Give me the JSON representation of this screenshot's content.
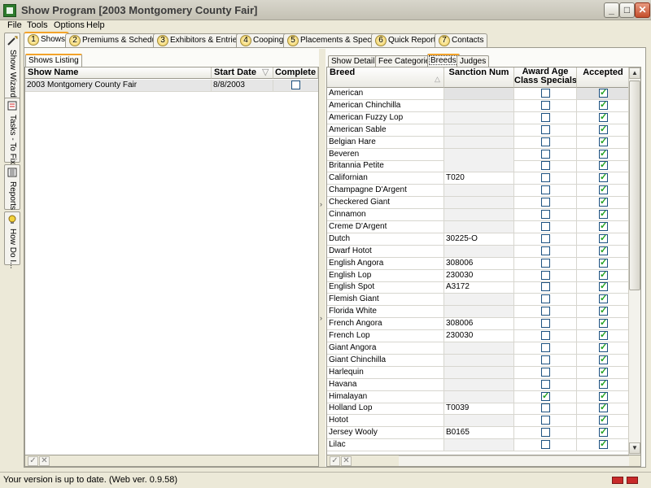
{
  "window": {
    "title": "Show Program [2003 Montgomery County Fair]"
  },
  "menu": [
    "File",
    "Tools",
    "Options",
    "Help"
  ],
  "sidebar": [
    {
      "label": "Show Wizard",
      "icon": "wizard-icon"
    },
    {
      "label": "Tasks - To Fix",
      "icon": "tasks-icon"
    },
    {
      "label": "Reports",
      "icon": "reports-icon"
    },
    {
      "label": "How Do I...",
      "icon": "help-bulb-icon"
    }
  ],
  "main_tabs": [
    {
      "num": "1",
      "label": "Shows"
    },
    {
      "num": "2",
      "label": "Premiums & Schedules"
    },
    {
      "num": "3",
      "label": "Exhibitors & Entries"
    },
    {
      "num": "4",
      "label": "Cooping"
    },
    {
      "num": "5",
      "label": "Placements & Specials"
    },
    {
      "num": "6",
      "label": "Quick Reports"
    },
    {
      "num": "7",
      "label": "Contacts"
    }
  ],
  "left_panel": {
    "tab": "Shows Listing",
    "headers": {
      "name": "Show Name",
      "date": "Start Date",
      "complete": "Complete"
    },
    "rows": [
      {
        "name": "2003 Montgomery County Fair",
        "date": "8/8/2003",
        "complete": false
      }
    ]
  },
  "right_panel": {
    "tabs": [
      "Show Details",
      "Fee Categories",
      "Breeds",
      "Judges"
    ],
    "headers": {
      "breed": "Breed",
      "sanction": "Sanction Num",
      "award1": "Award Age",
      "award2": "Class Specials",
      "accepted": "Accepted"
    },
    "rows": [
      {
        "breed": "American",
        "sanction": "",
        "award": false,
        "accepted": true
      },
      {
        "breed": "American Chinchilla",
        "sanction": "",
        "award": false,
        "accepted": true
      },
      {
        "breed": "American Fuzzy Lop",
        "sanction": "",
        "award": false,
        "accepted": true
      },
      {
        "breed": "American Sable",
        "sanction": "",
        "award": false,
        "accepted": true
      },
      {
        "breed": "Belgian Hare",
        "sanction": "",
        "award": false,
        "accepted": true
      },
      {
        "breed": "Beveren",
        "sanction": "",
        "award": false,
        "accepted": true
      },
      {
        "breed": "Britannia Petite",
        "sanction": "",
        "award": false,
        "accepted": true
      },
      {
        "breed": "Californian",
        "sanction": "T020",
        "award": false,
        "accepted": true
      },
      {
        "breed": "Champagne D'Argent",
        "sanction": "",
        "award": false,
        "accepted": true
      },
      {
        "breed": "Checkered Giant",
        "sanction": "",
        "award": false,
        "accepted": true
      },
      {
        "breed": "Cinnamon",
        "sanction": "",
        "award": false,
        "accepted": true
      },
      {
        "breed": "Creme D'Argent",
        "sanction": "",
        "award": false,
        "accepted": true
      },
      {
        "breed": "Dutch",
        "sanction": "30225-O",
        "award": false,
        "accepted": true
      },
      {
        "breed": "Dwarf Hotot",
        "sanction": "",
        "award": false,
        "accepted": true
      },
      {
        "breed": "English Angora",
        "sanction": "308006",
        "award": false,
        "accepted": true
      },
      {
        "breed": "English Lop",
        "sanction": "230030",
        "award": false,
        "accepted": true
      },
      {
        "breed": "English Spot",
        "sanction": "A3172",
        "award": false,
        "accepted": true
      },
      {
        "breed": "Flemish Giant",
        "sanction": "",
        "award": false,
        "accepted": true
      },
      {
        "breed": "Florida White",
        "sanction": "",
        "award": false,
        "accepted": true
      },
      {
        "breed": "French Angora",
        "sanction": "308006",
        "award": false,
        "accepted": true
      },
      {
        "breed": "French Lop",
        "sanction": "230030",
        "award": false,
        "accepted": true
      },
      {
        "breed": "Giant Angora",
        "sanction": "",
        "award": false,
        "accepted": true
      },
      {
        "breed": "Giant Chinchilla",
        "sanction": "",
        "award": false,
        "accepted": true
      },
      {
        "breed": "Harlequin",
        "sanction": "",
        "award": false,
        "accepted": true
      },
      {
        "breed": "Havana",
        "sanction": "",
        "award": false,
        "accepted": true
      },
      {
        "breed": "Himalayan",
        "sanction": "",
        "award": true,
        "accepted": true
      },
      {
        "breed": "Holland Lop",
        "sanction": "T0039",
        "award": false,
        "accepted": true
      },
      {
        "breed": "Hotot",
        "sanction": "",
        "award": false,
        "accepted": true
      },
      {
        "breed": "Jersey Wooly",
        "sanction": "B0165",
        "award": false,
        "accepted": true
      },
      {
        "breed": "Lilac",
        "sanction": "",
        "award": false,
        "accepted": true
      }
    ]
  },
  "status": {
    "text": "Your version is up to date. (Web ver. 0.9.58)"
  },
  "colors": {
    "accent_tab": "#f3a32a",
    "check_green": "#21a121",
    "chrome": "#ece9d8"
  }
}
